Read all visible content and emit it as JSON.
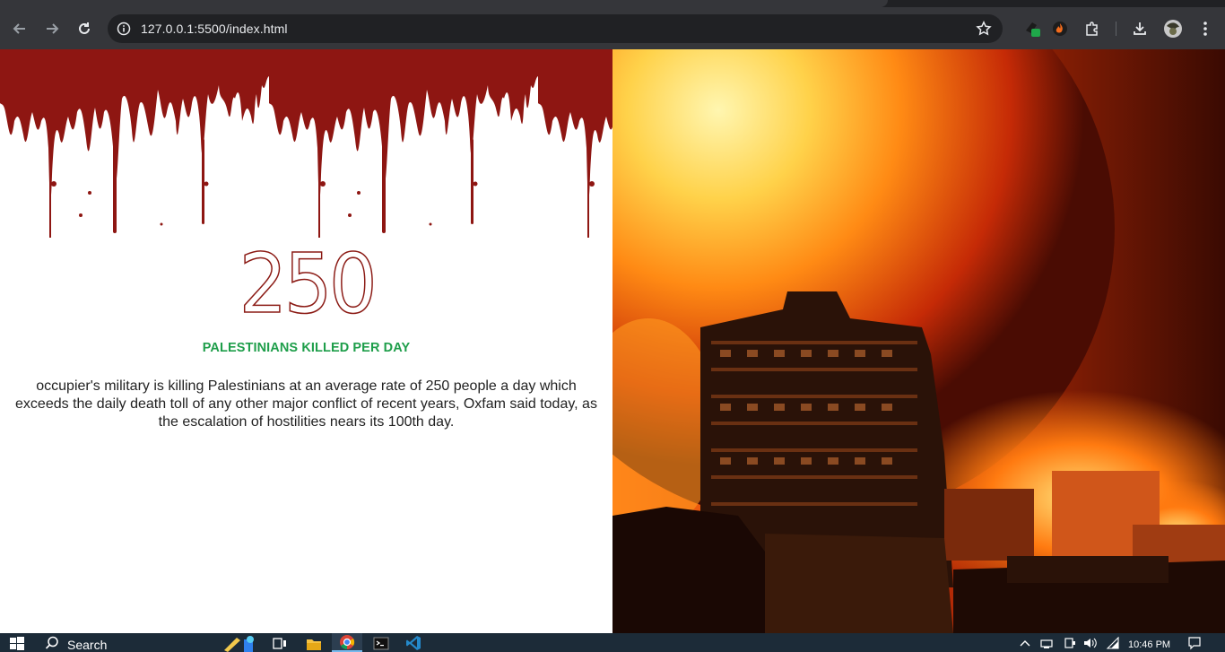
{
  "browser": {
    "url": "127.0.0.1:5500/index.html",
    "icons": [
      "back-icon",
      "forward-icon",
      "reload-icon",
      "site-info-icon",
      "bookmark-star-icon",
      "extension-icon",
      "extensions-puzzle-icon",
      "download-icon",
      "profile-avatar",
      "menu-icon"
    ]
  },
  "page": {
    "stat_number": "250",
    "stat_label": "PALESTINIANS KILLED PER DAY",
    "description": "occupier's military is killing Palestinians at an average rate of 250 people a day which exceeds the daily death toll of any other major conflict of recent years, Oxfam said today, as the escalation of hostilities nears its 100th day.",
    "colors": {
      "number": "#8b1a14",
      "label": "#1e9e4a",
      "blood": "#8e1612"
    }
  },
  "taskbar": {
    "search_label": "Search",
    "time": "10:46 PM",
    "icons": [
      "windows-start-icon",
      "search-icon",
      "widgets-icon",
      "task-view-icon",
      "file-explorer-icon",
      "chrome-icon",
      "terminal-icon",
      "vscode-icon",
      "tray-chevron-icon",
      "network-icon",
      "volume-icon",
      "wifi-icon",
      "notifications-icon"
    ]
  }
}
